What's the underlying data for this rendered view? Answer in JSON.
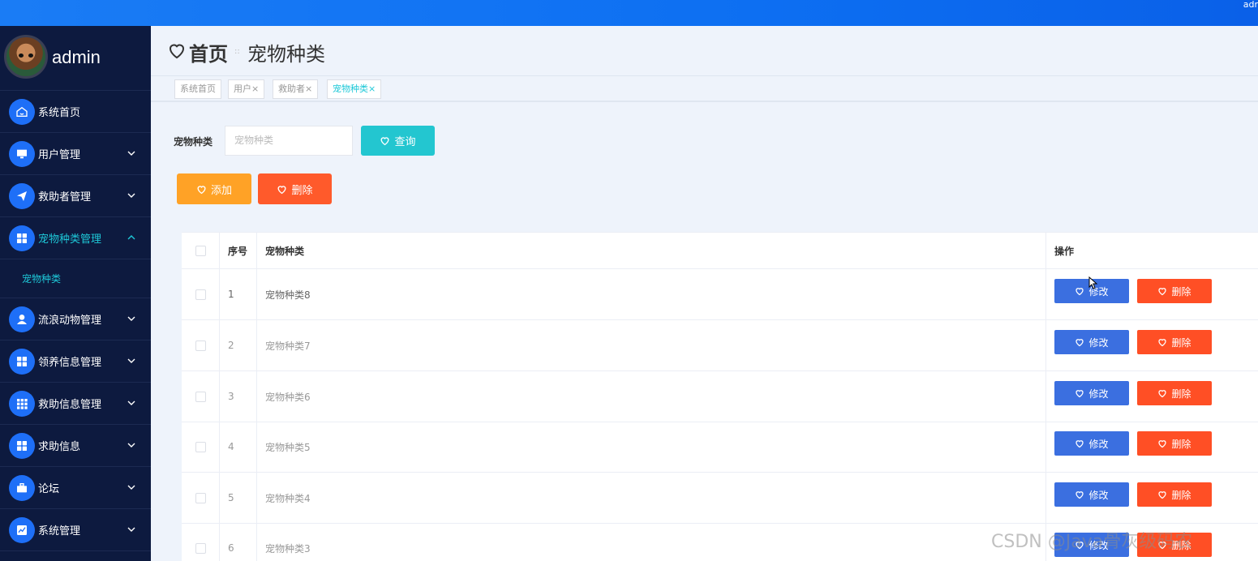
{
  "topbar": {
    "user": "adr"
  },
  "sidebar": {
    "username": "admin",
    "items": [
      {
        "label": "系统首页",
        "icon": "home-icon",
        "expandable": false
      },
      {
        "label": "用户管理",
        "icon": "monitor-icon",
        "expandable": true
      },
      {
        "label": "救助者管理",
        "icon": "send-icon",
        "expandable": true
      },
      {
        "label": "宠物种类管理",
        "icon": "grid-icon",
        "expandable": true,
        "active": true
      },
      {
        "label": "流浪动物管理",
        "icon": "user-icon",
        "expandable": true
      },
      {
        "label": "领养信息管理",
        "icon": "grid-icon",
        "expandable": true
      },
      {
        "label": "救助信息管理",
        "icon": "apps-icon",
        "expandable": true
      },
      {
        "label": "求助信息",
        "icon": "grid-icon",
        "expandable": true
      },
      {
        "label": "论坛",
        "icon": "briefcase-icon",
        "expandable": true
      },
      {
        "label": "系统管理",
        "icon": "chart-icon",
        "expandable": true
      }
    ],
    "submenu_label": "宠物种类"
  },
  "header": {
    "home": "首页",
    "separator": "::",
    "crumb": "宠物种类"
  },
  "tabs": [
    {
      "label": "系统首页"
    },
    {
      "label": "用户×"
    },
    {
      "label": "救助者×"
    },
    {
      "label": "宠物种类×",
      "active": true
    }
  ],
  "search": {
    "label": "宠物种类",
    "placeholder": "宠物种类",
    "query_label": "查询"
  },
  "actions": {
    "add_label": "添加",
    "delete_label": "删除"
  },
  "table": {
    "headers": {
      "index": "序号",
      "name": "宠物种类",
      "ops": "操作"
    },
    "rows": [
      {
        "index": "1",
        "name": "宠物种类8"
      },
      {
        "index": "2",
        "name": "宠物种类7"
      },
      {
        "index": "3",
        "name": "宠物种类6"
      },
      {
        "index": "4",
        "name": "宠物种类5"
      },
      {
        "index": "5",
        "name": "宠物种类4"
      },
      {
        "index": "6",
        "name": "宠物种类3"
      }
    ],
    "edit_label": "修改",
    "remove_label": "删除"
  },
  "watermark": "CSDN @Java骨灰级码农",
  "colors": {
    "sidebar": "#0d1a3f",
    "accent": "#1ec8d8",
    "primary": "#3b6fe0",
    "danger": "#ff4f25",
    "warning": "#ffa226"
  }
}
